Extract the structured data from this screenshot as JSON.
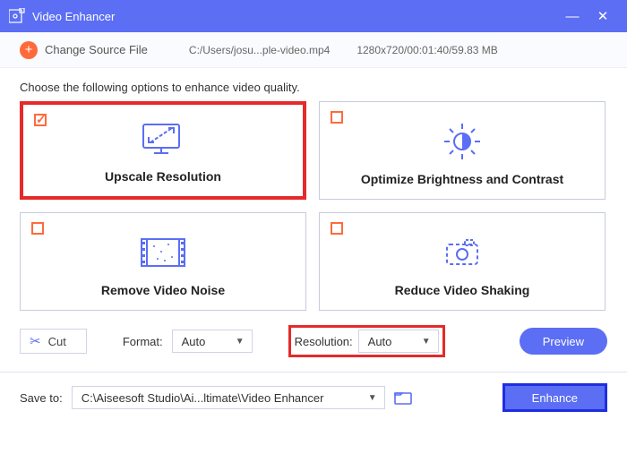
{
  "titlebar": {
    "title": "Video Enhancer"
  },
  "source": {
    "change_label": "Change Source File",
    "path": "C:/Users/josu...ple-video.mp4",
    "meta": "1280x720/00:01:40/59.83 MB"
  },
  "instruction": "Choose the following options to enhance video quality.",
  "cards": {
    "upscale": "Upscale Resolution",
    "brightness": "Optimize Brightness and Contrast",
    "noise": "Remove Video Noise",
    "shaking": "Reduce Video Shaking"
  },
  "toolbar": {
    "cut": "Cut",
    "format_label": "Format:",
    "format_value": "Auto",
    "resolution_label": "Resolution:",
    "resolution_value": "Auto",
    "preview": "Preview"
  },
  "save": {
    "label": "Save to:",
    "path": "C:\\Aiseesoft Studio\\Ai...ltimate\\Video Enhancer",
    "enhance": "Enhance"
  }
}
